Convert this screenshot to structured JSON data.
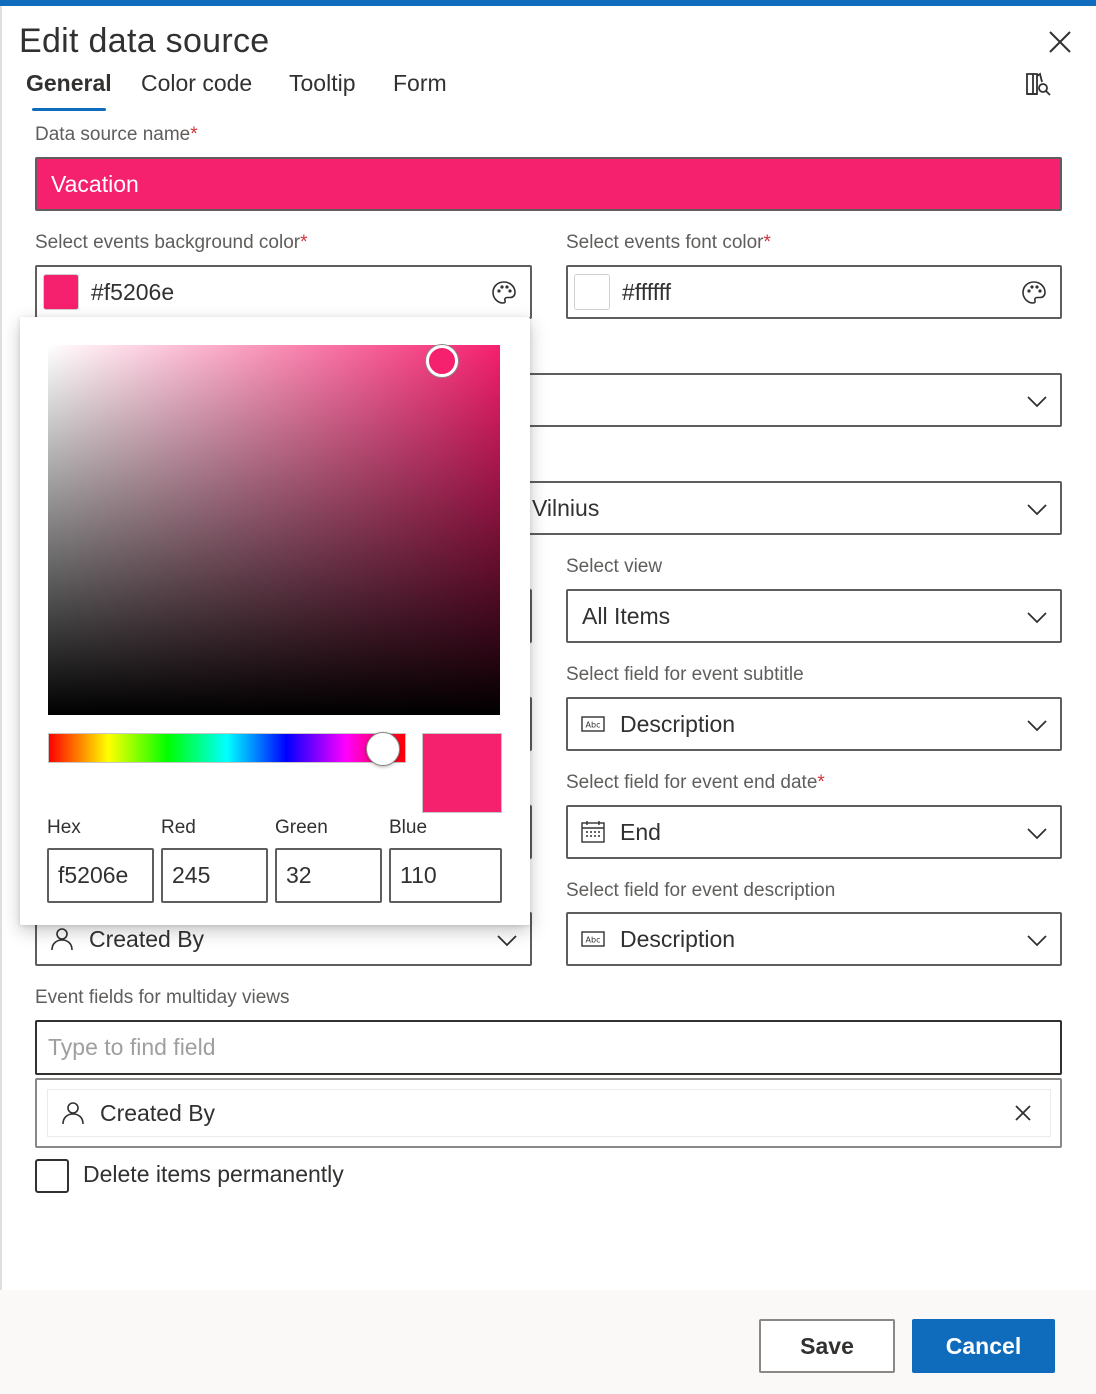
{
  "dialog": {
    "title": "Edit data source",
    "tabs": [
      {
        "label": "General",
        "active": true
      },
      {
        "label": "Color code",
        "active": false
      },
      {
        "label": "Tooltip",
        "active": false
      },
      {
        "label": "Form",
        "active": false
      }
    ]
  },
  "form": {
    "name": {
      "label": "Data source name",
      "required_mark": "*",
      "value": "Vacation",
      "background_color": "#f5206e"
    },
    "bg_color": {
      "label": "Select events background color",
      "required_mark": "*",
      "value": "#f5206e",
      "swatch": "#f5206e"
    },
    "font_color": {
      "label": "Select events font color",
      "required_mark": "*",
      "value": "#ffffff",
      "swatch": "#ffffff"
    },
    "timezone": {
      "value": "Vilnius"
    },
    "view": {
      "label": "Select view",
      "value": "All Items"
    },
    "subtitle_field": {
      "label": "Select field for event subtitle",
      "value": "Description",
      "icon": "text-field-icon"
    },
    "end_date_field": {
      "label": "Select field for event end date",
      "required_mark": "*",
      "value": "End",
      "icon": "calendar-icon"
    },
    "description_field": {
      "label": "Select field for event description",
      "value": "Description",
      "icon": "text-field-icon"
    },
    "created_by_field": {
      "value": "Created By",
      "icon": "person-icon"
    },
    "multiday": {
      "label": "Event fields for multiday views",
      "placeholder": "Type to find field",
      "selected": [
        {
          "label": "Created By",
          "icon": "person-icon"
        }
      ]
    },
    "delete_permanently": {
      "label": "Delete items permanently",
      "checked": false
    }
  },
  "color_picker": {
    "hex_label": "Hex",
    "red_label": "Red",
    "green_label": "Green",
    "blue_label": "Blue",
    "hex": "f5206e",
    "red": "245",
    "green": "32",
    "blue": "110",
    "color": "#f5206e"
  },
  "footer": {
    "save_label": "Save",
    "cancel_label": "Cancel"
  },
  "colors": {
    "accent": "#0f6cbd",
    "required": "#d13438"
  }
}
